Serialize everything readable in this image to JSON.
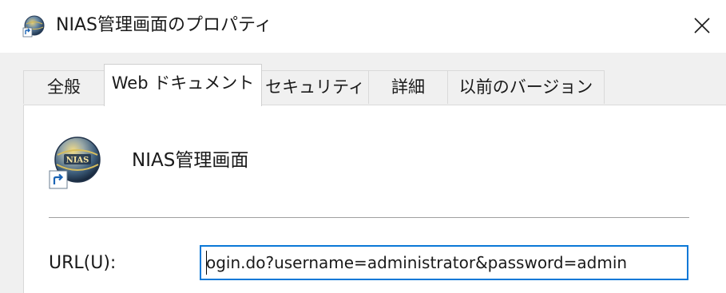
{
  "window": {
    "title": "NIAS管理画面のプロパティ",
    "icon": "globe-shortcut-icon",
    "close_icon": "close-icon"
  },
  "tabs": [
    {
      "label": "全般",
      "active": false
    },
    {
      "label": "Web ドキュメント",
      "active": true
    },
    {
      "label": "セキュリティ",
      "active": false
    },
    {
      "label": "詳細",
      "active": false
    },
    {
      "label": "以前のバージョン",
      "active": false
    }
  ],
  "document": {
    "name": "NIAS管理画面",
    "icon": "nias-globe-shortcut-icon",
    "icon_text": "NIAS"
  },
  "url": {
    "label": "URL(U):",
    "value": "ogin.do?username=administrator&password=admin"
  },
  "colors": {
    "accent": "#0a78d7",
    "dialog_background": "#f0f0f0",
    "page_background": "#ffffff"
  }
}
